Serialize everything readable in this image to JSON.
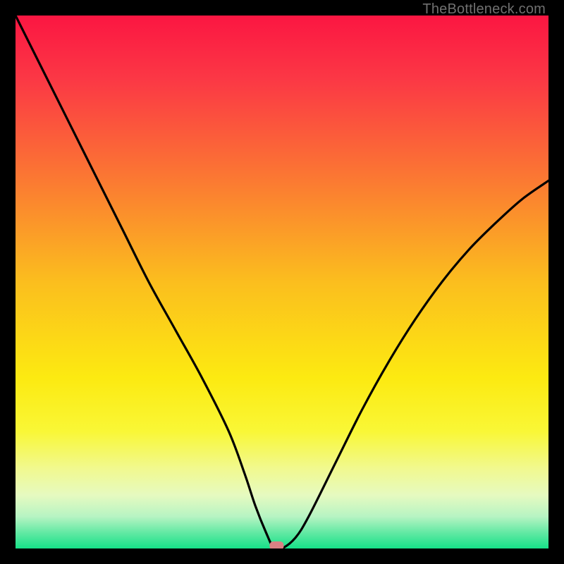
{
  "watermark": "TheBottleneck.com",
  "chart_data": {
    "type": "line",
    "title": "",
    "xlabel": "",
    "ylabel": "",
    "xlim": [
      0,
      100
    ],
    "ylim": [
      0,
      100
    ],
    "grid": false,
    "legend": false,
    "series": [
      {
        "name": "curve",
        "x": [
          0,
          5,
          10,
          15,
          20,
          25,
          30,
          35,
          40,
          43,
          45,
          47,
          48.5,
          50,
          52.5,
          55,
          60,
          65,
          70,
          75,
          80,
          85,
          90,
          95,
          100
        ],
        "y": [
          100,
          90,
          80,
          70,
          60,
          50,
          41,
          32,
          22,
          14,
          8,
          3,
          0,
          0,
          2,
          6,
          16,
          26,
          35,
          43,
          50,
          56,
          61,
          65.5,
          69
        ]
      }
    ],
    "marker": {
      "x": 49,
      "y": 0,
      "color": "#da8184"
    },
    "background_gradient": {
      "stops": [
        {
          "offset": 0.0,
          "color": "#fb1642"
        },
        {
          "offset": 0.12,
          "color": "#fb3845"
        },
        {
          "offset": 0.3,
          "color": "#fb7633"
        },
        {
          "offset": 0.5,
          "color": "#fbbe1e"
        },
        {
          "offset": 0.68,
          "color": "#fcea11"
        },
        {
          "offset": 0.78,
          "color": "#f9f736"
        },
        {
          "offset": 0.85,
          "color": "#f1f98f"
        },
        {
          "offset": 0.9,
          "color": "#e6fac0"
        },
        {
          "offset": 0.94,
          "color": "#b7f4c3"
        },
        {
          "offset": 0.97,
          "color": "#63e9a4"
        },
        {
          "offset": 1.0,
          "color": "#16e188"
        }
      ]
    }
  }
}
